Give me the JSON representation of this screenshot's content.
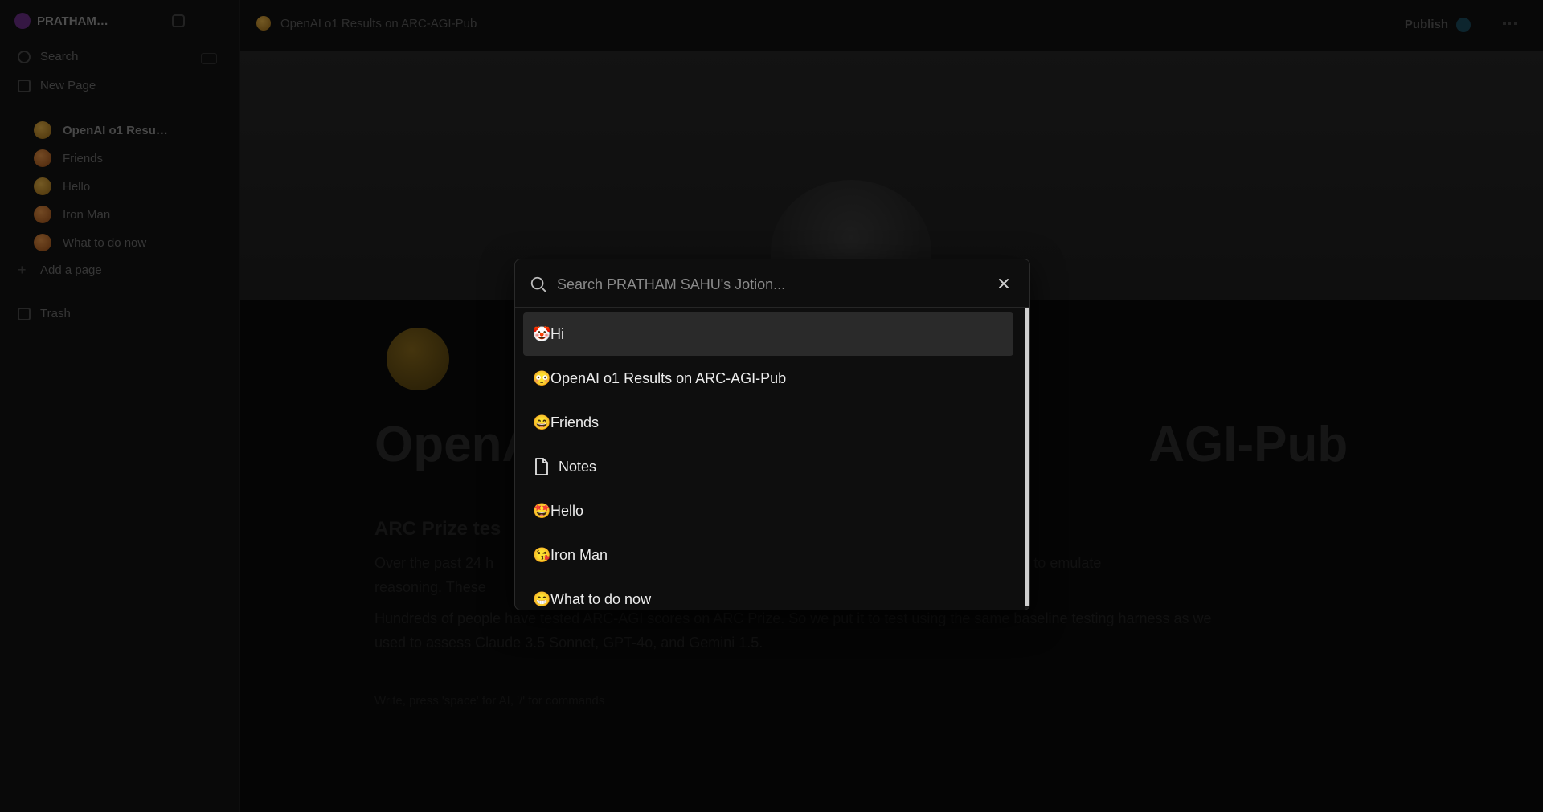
{
  "sidebar": {
    "workspace": "PRATHAM…",
    "search_label": "Search",
    "new_page_label": "New Page",
    "pages": [
      {
        "label": "OpenAI o1 Resu…"
      },
      {
        "label": "Friends"
      },
      {
        "label": "Hello"
      },
      {
        "label": "Iron Man"
      },
      {
        "label": "What to do now"
      }
    ],
    "add_page_label": "Add a page",
    "trash_label": "Trash"
  },
  "topbar": {
    "title": "OpenAI o1 Results on ARC-AGI-Pub",
    "publish_label": "Publish"
  },
  "page": {
    "title_left": "OpenA",
    "title_right": "AGI-Pub",
    "h2": "ARC Prize tes",
    "p1": "Over the past 24 h                                                                                    which models generally trained to emulate",
    "p2": "reasoning. These                                                                                       before giving a final answer.",
    "p3": "Hundreds of people have tested ARC-AGI scores on ARC Prize. So we put it to test using the same baseline testing harness as we",
    "p4": "used to assess Claude 3.5 Sonnet, GPT-4o, and Gemini 1.5.",
    "footer": "Write, press 'space' for AI, '/' for commands"
  },
  "search": {
    "placeholder": "Search PRATHAM SAHU's Jotion...",
    "results": [
      {
        "emoji": "🤡",
        "label": "Hi"
      },
      {
        "emoji": "😳",
        "label": "OpenAI o1 Results on ARC-AGI-Pub"
      },
      {
        "emoji": "😄",
        "label": "Friends"
      },
      {
        "emoji": "",
        "label": "Notes"
      },
      {
        "emoji": "🤩",
        "label": "Hello"
      },
      {
        "emoji": "😘",
        "label": "Iron Man"
      },
      {
        "emoji": "😁",
        "label": "What to do now"
      }
    ]
  },
  "colors": {
    "modal_bg": "#0e0e0e",
    "selected_bg": "#2a2a2a",
    "text": "#ededed"
  }
}
